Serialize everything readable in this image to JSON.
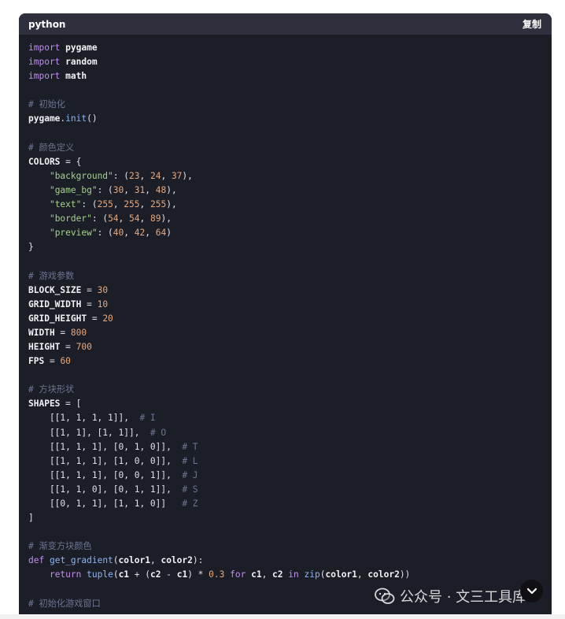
{
  "header": {
    "language": "python",
    "copy_label": "复制"
  },
  "watermark": {
    "text": "公众号 · 文三工具库"
  },
  "code_lines": [
    [
      [
        "kw",
        "import"
      ],
      [
        "pl",
        " "
      ],
      [
        "id",
        "pygame"
      ]
    ],
    [
      [
        "kw",
        "import"
      ],
      [
        "pl",
        " "
      ],
      [
        "id",
        "random"
      ]
    ],
    [
      [
        "kw",
        "import"
      ],
      [
        "pl",
        " "
      ],
      [
        "id",
        "math"
      ]
    ],
    [],
    [
      [
        "cm",
        "# 初始化"
      ]
    ],
    [
      [
        "id",
        "pygame"
      ],
      [
        "pl",
        "."
      ],
      [
        "fn",
        "init"
      ],
      [
        "pl",
        "()"
      ]
    ],
    [],
    [
      [
        "cm",
        "# 颜色定义"
      ]
    ],
    [
      [
        "id",
        "COLORS"
      ],
      [
        "pl",
        " = {"
      ]
    ],
    [
      [
        "pl",
        "    "
      ],
      [
        "str",
        "\"background\""
      ],
      [
        "pl",
        ": ("
      ],
      [
        "num",
        "23"
      ],
      [
        "pl",
        ", "
      ],
      [
        "num",
        "24"
      ],
      [
        "pl",
        ", "
      ],
      [
        "num",
        "37"
      ],
      [
        "pl",
        "),"
      ]
    ],
    [
      [
        "pl",
        "    "
      ],
      [
        "str",
        "\"game_bg\""
      ],
      [
        "pl",
        ": ("
      ],
      [
        "num",
        "30"
      ],
      [
        "pl",
        ", "
      ],
      [
        "num",
        "31"
      ],
      [
        "pl",
        ", "
      ],
      [
        "num",
        "48"
      ],
      [
        "pl",
        "),"
      ]
    ],
    [
      [
        "pl",
        "    "
      ],
      [
        "str",
        "\"text\""
      ],
      [
        "pl",
        ": ("
      ],
      [
        "num",
        "255"
      ],
      [
        "pl",
        ", "
      ],
      [
        "num",
        "255"
      ],
      [
        "pl",
        ", "
      ],
      [
        "num",
        "255"
      ],
      [
        "pl",
        "),"
      ]
    ],
    [
      [
        "pl",
        "    "
      ],
      [
        "str",
        "\"border\""
      ],
      [
        "pl",
        ": ("
      ],
      [
        "num",
        "54"
      ],
      [
        "pl",
        ", "
      ],
      [
        "num",
        "54"
      ],
      [
        "pl",
        ", "
      ],
      [
        "num",
        "89"
      ],
      [
        "pl",
        "),"
      ]
    ],
    [
      [
        "pl",
        "    "
      ],
      [
        "str",
        "\"preview\""
      ],
      [
        "pl",
        ": ("
      ],
      [
        "num",
        "40"
      ],
      [
        "pl",
        ", "
      ],
      [
        "num",
        "42"
      ],
      [
        "pl",
        ", "
      ],
      [
        "num",
        "64"
      ],
      [
        "pl",
        ")"
      ]
    ],
    [
      [
        "pl",
        "}"
      ]
    ],
    [],
    [
      [
        "cm",
        "# 游戏参数"
      ]
    ],
    [
      [
        "id",
        "BLOCK_SIZE"
      ],
      [
        "pl",
        " = "
      ],
      [
        "num",
        "30"
      ]
    ],
    [
      [
        "id",
        "GRID_WIDTH"
      ],
      [
        "pl",
        " = "
      ],
      [
        "num",
        "10"
      ]
    ],
    [
      [
        "id",
        "GRID_HEIGHT"
      ],
      [
        "pl",
        " = "
      ],
      [
        "num",
        "20"
      ]
    ],
    [
      [
        "id",
        "WIDTH"
      ],
      [
        "pl",
        " = "
      ],
      [
        "num",
        "800"
      ]
    ],
    [
      [
        "id",
        "HEIGHT"
      ],
      [
        "pl",
        " = "
      ],
      [
        "num",
        "700"
      ]
    ],
    [
      [
        "id",
        "FPS"
      ],
      [
        "pl",
        " = "
      ],
      [
        "num",
        "60"
      ]
    ],
    [],
    [
      [
        "cm",
        "# 方块形状"
      ]
    ],
    [
      [
        "id",
        "SHAPES"
      ],
      [
        "pl",
        " = ["
      ]
    ],
    [
      [
        "pl",
        "    [[1, 1, 1, 1]],  "
      ],
      [
        "cm",
        "# I"
      ]
    ],
    [
      [
        "pl",
        "    [[1, 1], [1, 1]],  "
      ],
      [
        "cm",
        "# O"
      ]
    ],
    [
      [
        "pl",
        "    [[1, 1, 1], [0, 1, 0]],  "
      ],
      [
        "cm",
        "# T"
      ]
    ],
    [
      [
        "pl",
        "    [[1, 1, 1], [1, 0, 0]],  "
      ],
      [
        "cm",
        "# L"
      ]
    ],
    [
      [
        "pl",
        "    [[1, 1, 1], [0, 0, 1]],  "
      ],
      [
        "cm",
        "# J"
      ]
    ],
    [
      [
        "pl",
        "    [[1, 1, 0], [0, 1, 1]],  "
      ],
      [
        "cm",
        "# S"
      ]
    ],
    [
      [
        "pl",
        "    [[0, 1, 1], [1, 1, 0]]   "
      ],
      [
        "cm",
        "# Z"
      ]
    ],
    [
      [
        "pl",
        "]"
      ]
    ],
    [],
    [
      [
        "cm",
        "# 渐变方块颜色"
      ]
    ],
    [
      [
        "kw",
        "def"
      ],
      [
        "pl",
        " "
      ],
      [
        "fn",
        "get_gradient"
      ],
      [
        "pl",
        "("
      ],
      [
        "id",
        "color1"
      ],
      [
        "pl",
        ", "
      ],
      [
        "id",
        "color2"
      ],
      [
        "pl",
        "):"
      ]
    ],
    [
      [
        "pl",
        "    "
      ],
      [
        "kw",
        "return"
      ],
      [
        "pl",
        " "
      ],
      [
        "fn",
        "tuple"
      ],
      [
        "pl",
        "("
      ],
      [
        "id",
        "c1"
      ],
      [
        "pl",
        " + ("
      ],
      [
        "id",
        "c2"
      ],
      [
        "pl",
        " - "
      ],
      [
        "id",
        "c1"
      ],
      [
        "pl",
        ") * "
      ],
      [
        "num",
        "0.3"
      ],
      [
        "pl",
        " "
      ],
      [
        "kw",
        "for"
      ],
      [
        "pl",
        " "
      ],
      [
        "id",
        "c1"
      ],
      [
        "pl",
        ", "
      ],
      [
        "id",
        "c2"
      ],
      [
        "pl",
        " "
      ],
      [
        "kw",
        "in"
      ],
      [
        "pl",
        " "
      ],
      [
        "fn",
        "zip"
      ],
      [
        "pl",
        "("
      ],
      [
        "id",
        "color1"
      ],
      [
        "pl",
        ", "
      ],
      [
        "id",
        "color2"
      ],
      [
        "pl",
        "))"
      ]
    ],
    [],
    [
      [
        "cm",
        "# 初始化游戏窗口"
      ]
    ]
  ]
}
